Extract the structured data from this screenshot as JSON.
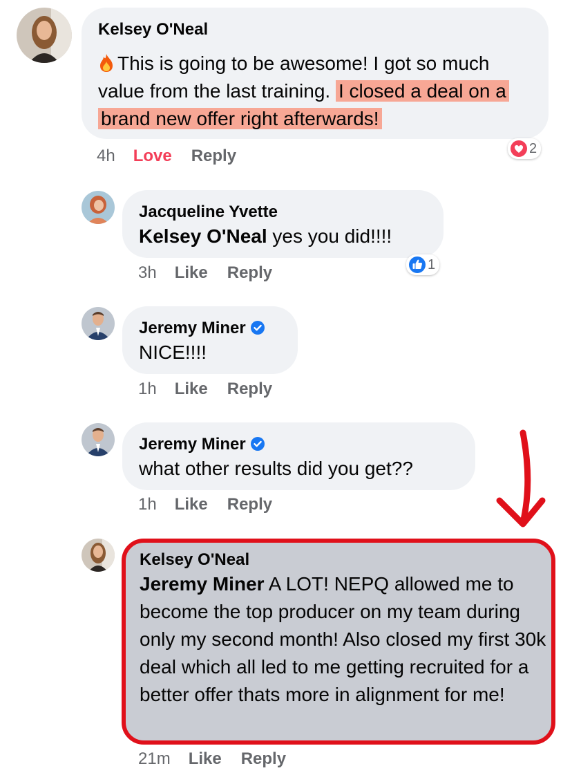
{
  "comments": [
    {
      "author": "Kelsey O'Neal",
      "text_before": "This is going to be awesome! I got so much value from the last training.",
      "text_highlight": "I closed a deal on a brand new offer right afterwards!",
      "time": "4h",
      "reaction_label": "Love",
      "reply_label": "Reply",
      "reaction_count": "2",
      "reaction_icon": "heart-icon"
    },
    {
      "author": "Jacqueline Yvette",
      "mention": "Kelsey O'Neal",
      "text": " yes you did!!!!",
      "time": "3h",
      "reaction_label": "Like",
      "reply_label": "Reply",
      "reaction_count": "1",
      "reaction_icon": "thumbs-up-icon"
    },
    {
      "author": "Jeremy Miner",
      "verified": true,
      "text": "NICE!!!!",
      "time": "1h",
      "reaction_label": "Like",
      "reply_label": "Reply"
    },
    {
      "author": "Jeremy Miner",
      "verified": true,
      "text": "what other results did you get??",
      "time": "1h",
      "reaction_label": "Like",
      "reply_label": "Reply"
    },
    {
      "author": "Kelsey O'Neal",
      "mention": "Jeremy Miner",
      "text": " A LOT! NEPQ allowed me to become the top producer on my team during only my second month! Also closed my first 30k deal which all led to me getting recruited for a better offer thats more in alignment for me!",
      "time": "21m",
      "reaction_label": "Like",
      "reply_label": "Reply"
    }
  ],
  "colors": {
    "bubble": "#f0f2f5",
    "highlighted_bubble": "#c9ccd3",
    "highlight": "#f7a795",
    "annotation": "#e0101a",
    "love": "#f33e58",
    "like": "#1877f2",
    "meta": "#65676b"
  }
}
